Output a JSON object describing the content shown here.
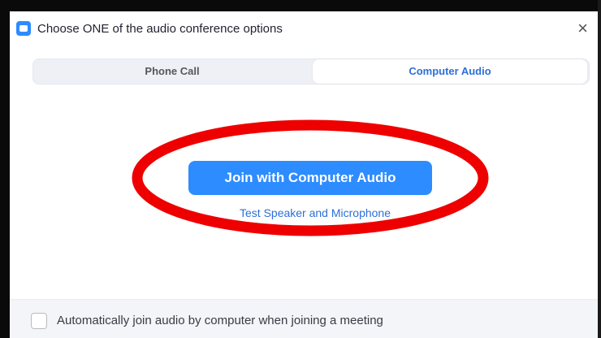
{
  "dialog": {
    "title": "Choose ONE of the audio conference options",
    "close_glyph": "×",
    "app_icon": "zoom-camera-icon"
  },
  "tabs": [
    {
      "label": "Phone Call",
      "selected": false
    },
    {
      "label": "Computer Audio",
      "selected": true
    }
  ],
  "main": {
    "join_button_label": "Join with Computer Audio",
    "test_link_label": "Test Speaker and Microphone"
  },
  "footer": {
    "auto_join_label": "Automatically join audio by computer when joining a meeting",
    "auto_join_checked": false
  },
  "colors": {
    "accent": "#2d8cff",
    "link": "#2d6fd6",
    "annotation": "#ee0000"
  }
}
